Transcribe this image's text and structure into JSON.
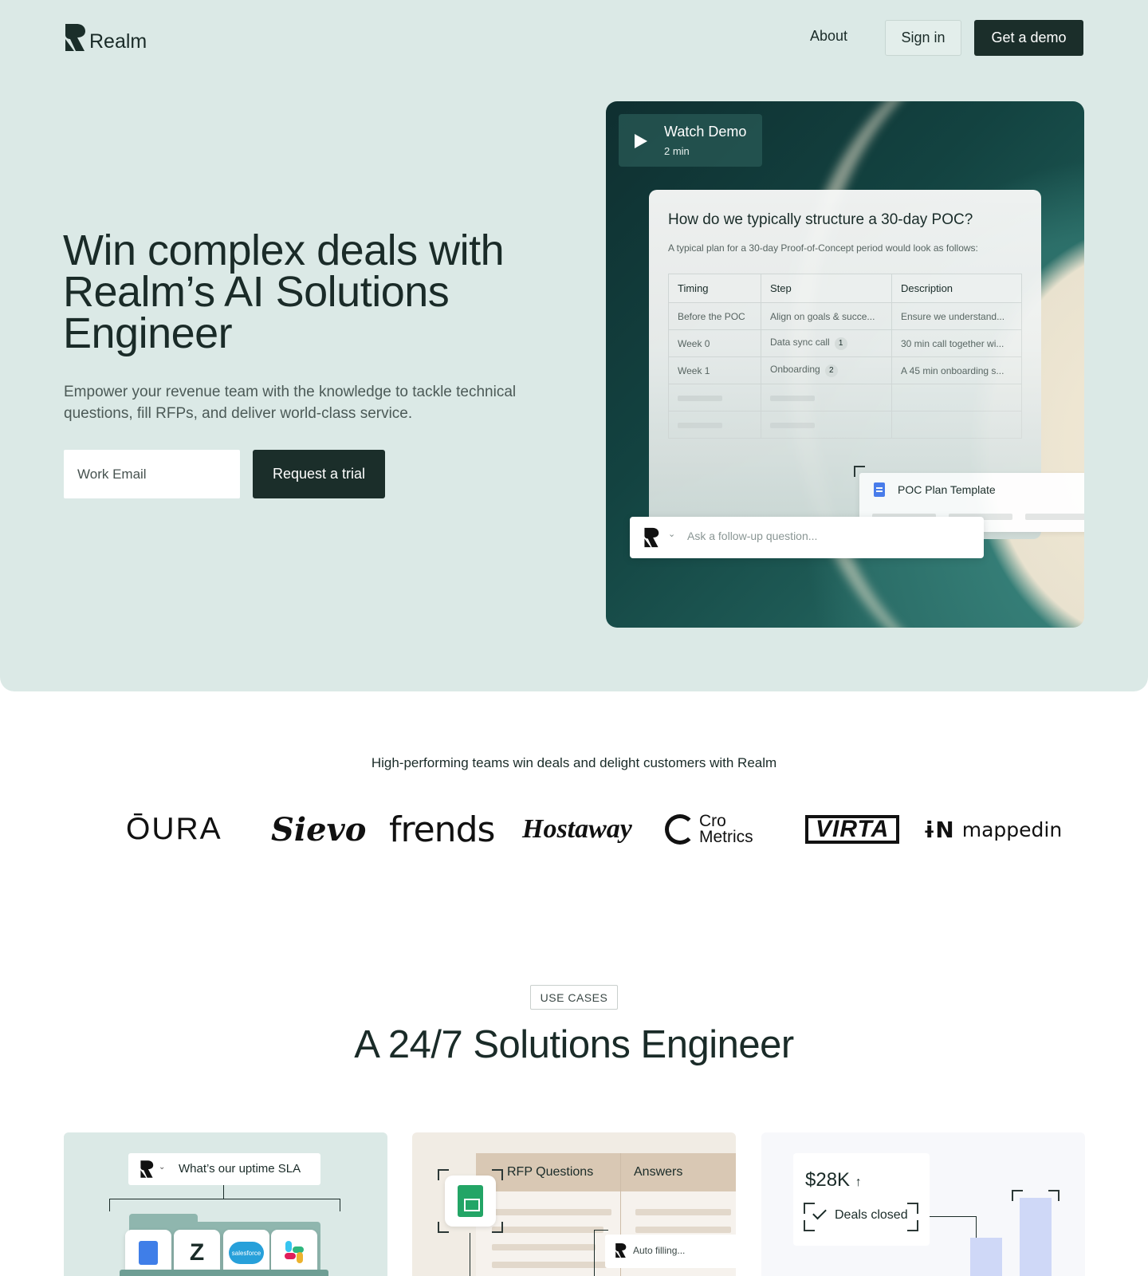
{
  "brand": {
    "name": "Realm"
  },
  "nav": {
    "about": "About",
    "sign_in": "Sign in",
    "get_demo": "Get a demo"
  },
  "hero": {
    "title": "Win complex deals with Realm’s AI Solutions Engineer",
    "subtitle": "Empower your revenue team with the knowledge to tackle technical questions, fill RFPs, and deliver world-class service.",
    "email_placeholder": "Work Email",
    "cta": "Request a trial"
  },
  "demo": {
    "watch_title": "Watch Demo",
    "watch_duration": "2 min",
    "question": "How do we typically structure a 30-day POC?",
    "answer_intro": "A typical plan for a 30-day Proof-of-Concept period would look as follows:",
    "table": {
      "headers": [
        "Timing",
        "Step",
        "Description"
      ],
      "rows": [
        {
          "timing": "Before the POC",
          "step": "Align on goals & succe...",
          "badge": "",
          "description": "Ensure we understand..."
        },
        {
          "timing": "Week 0",
          "step": "Data sync call",
          "badge": "1",
          "description": "30 min call together wi..."
        },
        {
          "timing": "Week 1",
          "step": "Onboarding",
          "badge": "2",
          "description": "A 45 min onboarding s..."
        }
      ]
    },
    "template_card": "POC Plan Template",
    "followup_placeholder": "Ask a follow-up question..."
  },
  "trust": {
    "headline": "High-performing teams win deals and delight customers with Realm",
    "logos": {
      "oura": "ŌURA",
      "sievo": "Sievo",
      "frends": "frends",
      "hostaway": "Hostaway",
      "cro_line1": "Cro",
      "cro_line2": "Metrics",
      "virta": "VIRTA",
      "mappedin_mark": "ɨN",
      "mappedin": "mappedin"
    }
  },
  "use_cases": {
    "tag": "USE CASES",
    "title": "A 24/7 Solutions Engineer",
    "card1": {
      "query": "What’s our uptime SLA"
    },
    "card2": {
      "col_questions": "RFP Questions",
      "col_answers": "Answers",
      "status": "Auto filling..."
    },
    "card3": {
      "amount": "$28K",
      "trend_icon": "arrow-up-icon",
      "label": "Deals closed"
    }
  },
  "colors": {
    "hero_bg": "#dbe9e6",
    "primary_dark": "#1b2e2a",
    "text": "#1a2b28"
  }
}
